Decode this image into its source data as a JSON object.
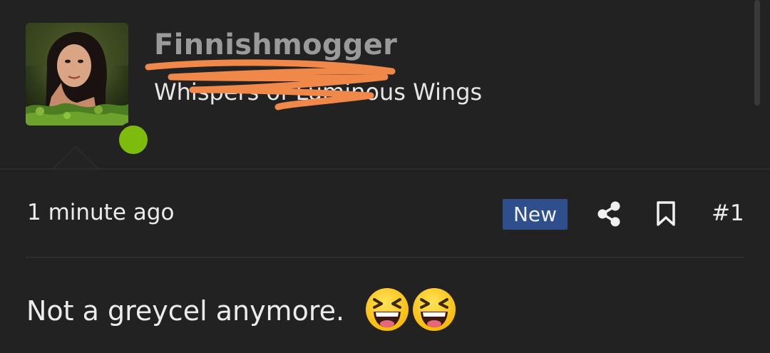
{
  "header": {
    "username": "Finnishmogger",
    "user_title": "Whispers of Luminous Wings"
  },
  "post": {
    "time": "1 minute ago",
    "badge": "New",
    "number": "#1",
    "body": "Not a greycel anymore."
  },
  "icons": {
    "share": "share-icon",
    "bookmark": "bookmark-icon",
    "emoji": "laughing-face-emoji"
  },
  "colors": {
    "online": "#7dbb0d",
    "badge_bg": "#2f4f8c",
    "scribble": "#f0884a",
    "background": "#222222"
  }
}
